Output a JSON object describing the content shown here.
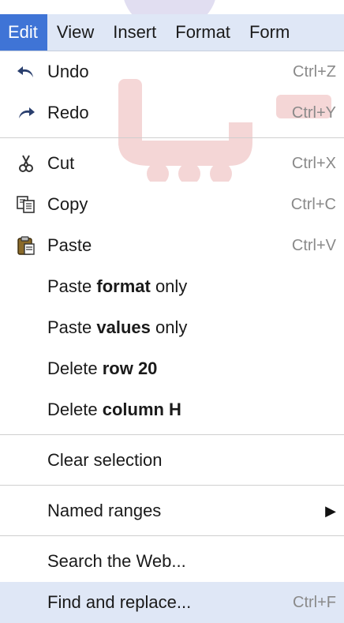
{
  "menubar": {
    "items": [
      {
        "label": "Edit",
        "active": true
      },
      {
        "label": "View",
        "active": false
      },
      {
        "label": "Insert",
        "active": false
      },
      {
        "label": "Format",
        "active": false
      },
      {
        "label": "Form",
        "active": false
      }
    ]
  },
  "menu": {
    "undo": {
      "label": "Undo",
      "shortcut": "Ctrl+Z",
      "icon": "undo-icon"
    },
    "redo": {
      "label": "Redo",
      "shortcut": "Ctrl+Y",
      "icon": "redo-icon"
    },
    "cut": {
      "label": "Cut",
      "shortcut": "Ctrl+X",
      "icon": "scissors-icon"
    },
    "copy": {
      "label": "Copy",
      "shortcut": "Ctrl+C",
      "icon": "copy-icon"
    },
    "paste": {
      "label": "Paste",
      "shortcut": "Ctrl+V",
      "icon": "clipboard-icon"
    },
    "paste_format": {
      "pre": "Paste ",
      "bold": "format",
      "post": " only"
    },
    "paste_values": {
      "pre": "Paste ",
      "bold": "values",
      "post": " only"
    },
    "delete_row": {
      "pre": "Delete ",
      "bold": "row 20"
    },
    "delete_column": {
      "pre": "Delete ",
      "bold": "column H"
    },
    "clear_selection": {
      "label": "Clear selection"
    },
    "named_ranges": {
      "label": "Named ranges",
      "submenu_glyph": "▶"
    },
    "search_web": {
      "label": "Search the Web..."
    },
    "find_replace": {
      "label": "Find and replace...",
      "shortcut": "Ctrl+F"
    }
  },
  "colors": {
    "menubar_bg": "#dfe7f6",
    "active_tab": "#3f74d6",
    "highlight_row": "#dfe7f6",
    "shortcut_text": "#8a8a8a"
  }
}
